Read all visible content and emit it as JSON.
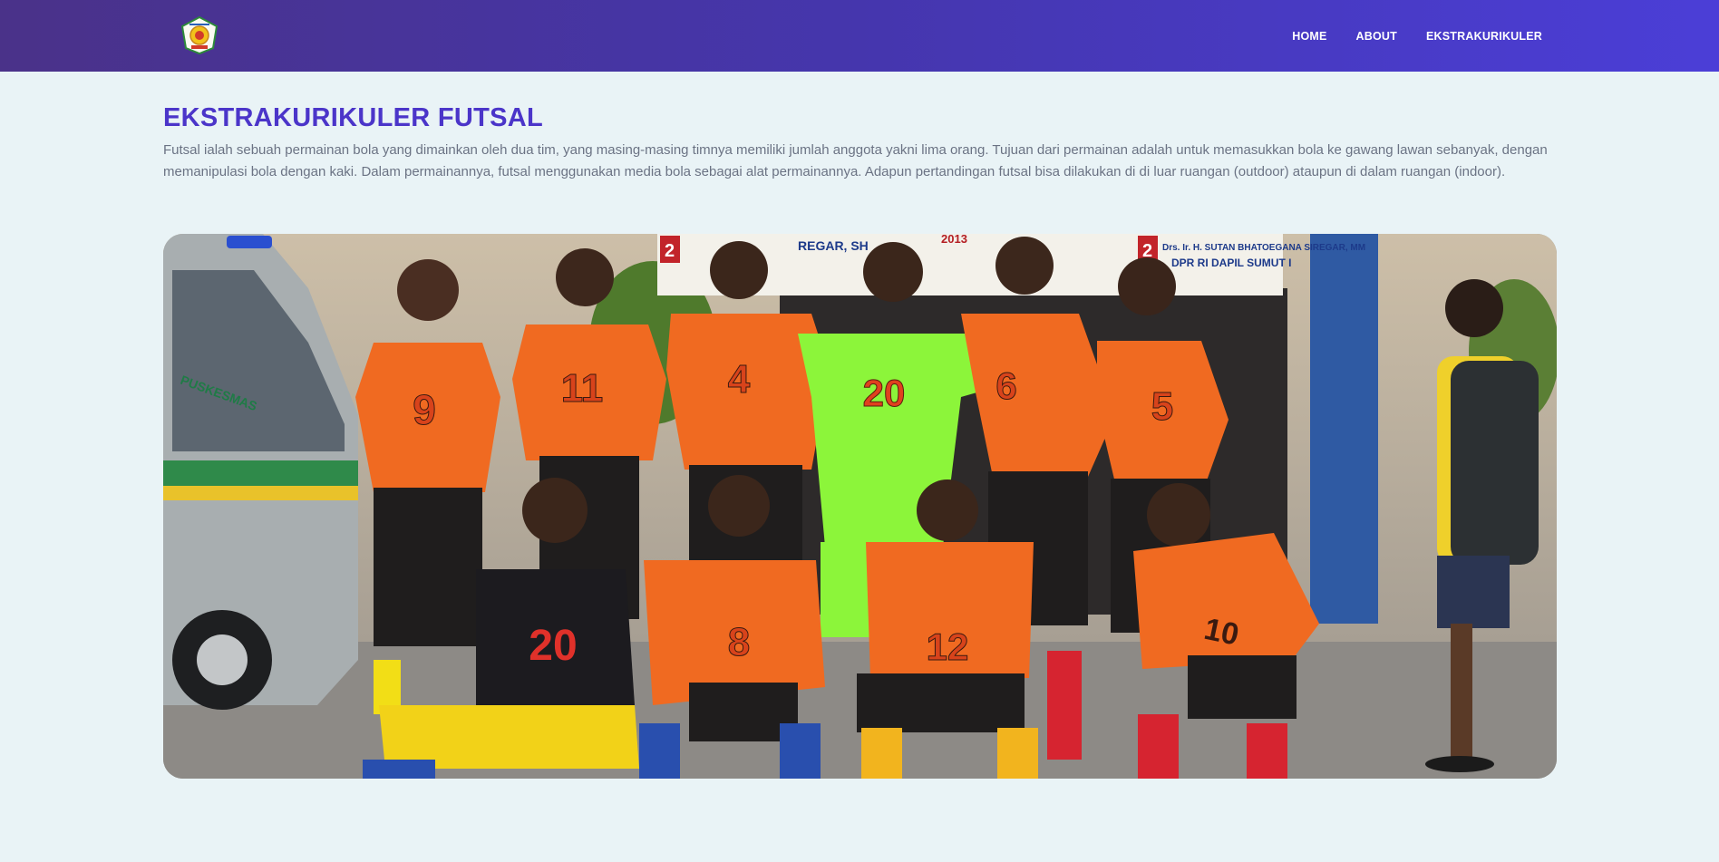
{
  "navbar": {
    "logo_icon": "school-crest-logo",
    "links": [
      {
        "label": "HOME"
      },
      {
        "label": "ABOUT"
      },
      {
        "label": "EKSTRAKURIKULER"
      }
    ]
  },
  "main": {
    "title": "EKSTRAKURIKULER FUTSAL",
    "description": "Futsal ialah sebuah permainan bola yang dimainkan oleh dua tim, yang masing-masing timnya memiliki jumlah anggota yakni lima orang. Tujuan dari permainan adalah untuk memasukkan bola ke gawang lawan sebanyak, dengan memanipulasi bola dengan kaki. Dalam permainannya, futsal menggunakan media bola sebagai alat permainannya. Adapun pertandingan futsal bisa dilakukan di di luar ruangan (outdoor) ataupun di dalam ruangan (indoor).",
    "photo": {
      "banner_left": "2",
      "banner_left_text": "REGAR, SH",
      "banner_right": "2",
      "banner_right_text": "Drs. Ir. H. SUTAN BHATOEGANA SIREGAR, MM",
      "banner_right_sub": "DPR RI DAPIL SUMUT I",
      "banner_middle": "2013",
      "van_text": "PUSKESMAS",
      "players_back": [
        {
          "number": "9"
        },
        {
          "number": "11"
        },
        {
          "number": "4"
        },
        {
          "number": "20"
        },
        {
          "number": "6"
        },
        {
          "number": "5"
        }
      ],
      "players_front": [
        {
          "number": "20"
        },
        {
          "number": "8"
        },
        {
          "number": "12"
        },
        {
          "number": "10"
        }
      ]
    }
  },
  "colors": {
    "nav_start": "#4a3289",
    "nav_end": "#4b3ed7",
    "title": "#4b35c9",
    "background": "#e9f3f6",
    "jersey_orange": "#f06a21",
    "keeper_green": "#8cf53a"
  }
}
